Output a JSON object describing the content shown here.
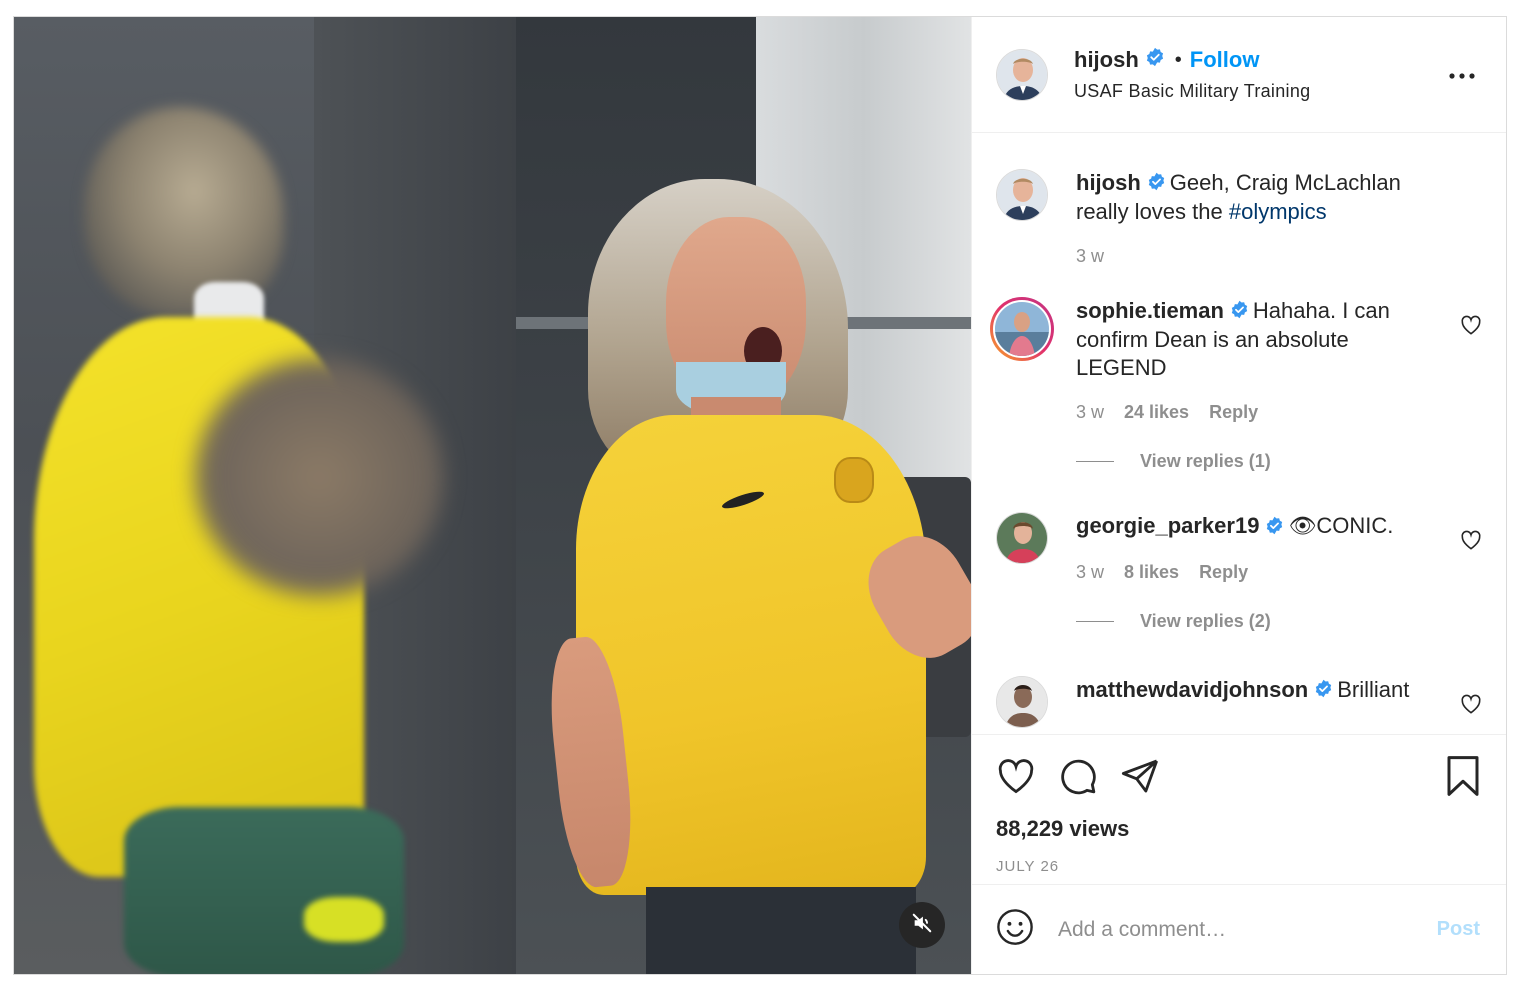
{
  "post": {
    "author": {
      "username": "hijosh",
      "verified": true,
      "follow_label": "Follow",
      "dot": "•",
      "location": "USAF Basic Military Training"
    },
    "media": {
      "type": "video",
      "muted": true
    },
    "caption": {
      "username": "hijosh",
      "text_before": "Geeh, Craig McLachlan really loves the ",
      "hashtag": "#olympics",
      "time": "3 w"
    },
    "comments": [
      {
        "username": "sophie.tieman",
        "verified": true,
        "text": "Hahaha. I can confirm Dean is an absolute LEGEND",
        "time": "3 w",
        "likes": "24 likes",
        "reply_label": "Reply",
        "view_replies": "View replies (1)",
        "has_story": true
      },
      {
        "username": "georgie_parker19",
        "verified": true,
        "text": "👁CONIC.",
        "time": "3 w",
        "likes": "8 likes",
        "reply_label": "Reply",
        "view_replies": "View replies (2)"
      },
      {
        "username": "matthewdavidjohnson",
        "verified": true,
        "text": "Brilliant"
      }
    ],
    "views": "88,229 views",
    "date": "JULY 26",
    "add_comment_placeholder": "Add a comment…",
    "post_label": "Post"
  },
  "colors": {
    "accent": "#0095f6",
    "post_disabled": "#b2dffc",
    "verified": "#3897f0",
    "muted_text": "#8e8e8e",
    "hashtag": "#00376b",
    "jersey_yellow": "#f2cc1f"
  },
  "icons": [
    "verified-icon",
    "more-icon",
    "heart-icon",
    "comment-icon",
    "share-icon",
    "bookmark-icon",
    "smile-icon",
    "mute-icon"
  ]
}
